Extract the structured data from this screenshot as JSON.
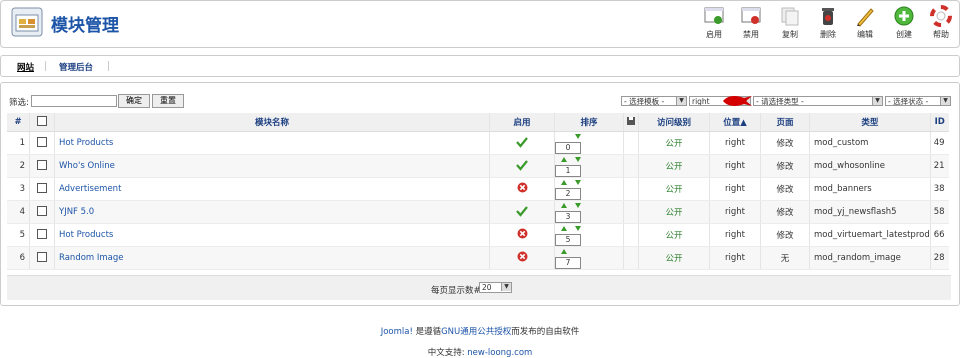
{
  "page_title": "模块管理",
  "toolbar": [
    {
      "label": "启用",
      "icon": "enable-icon"
    },
    {
      "label": "禁用",
      "icon": "disable-icon"
    },
    {
      "label": "复制",
      "icon": "copy-icon"
    },
    {
      "label": "删除",
      "icon": "trash-icon"
    },
    {
      "label": "编辑",
      "icon": "edit-icon"
    },
    {
      "label": "创建",
      "icon": "new-icon"
    },
    {
      "label": "帮助",
      "icon": "help-icon"
    }
  ],
  "tabs": [
    {
      "label": "网站",
      "active": true
    },
    {
      "label": "管理后台",
      "active": false
    }
  ],
  "filter": {
    "label": "筛选:",
    "value": "",
    "go_label": "确定",
    "reset_label": "重置",
    "template_select": "- 选择模板 -",
    "position_select": "right",
    "type_select": "- 请选择类型 -",
    "state_select": "- 选择状态 -"
  },
  "columns": {
    "num": "#",
    "name": "模块名称",
    "enabled": "启用",
    "order": "排序",
    "access": "访问级别",
    "position": "位置",
    "pages": "页面",
    "type": "类型",
    "id": "ID"
  },
  "rows": [
    {
      "num": "1",
      "name": "Hot Products",
      "enabled": true,
      "up": false,
      "down": true,
      "order": "0",
      "access": "公开",
      "position": "right",
      "pages": "修改",
      "type": "mod_custom",
      "id": "49"
    },
    {
      "num": "2",
      "name": "Who's Online",
      "enabled": true,
      "up": true,
      "down": true,
      "order": "1",
      "access": "公开",
      "position": "right",
      "pages": "修改",
      "type": "mod_whosonline",
      "id": "21"
    },
    {
      "num": "3",
      "name": "Advertisement",
      "enabled": false,
      "up": true,
      "down": true,
      "order": "2",
      "access": "公开",
      "position": "right",
      "pages": "修改",
      "type": "mod_banners",
      "id": "38"
    },
    {
      "num": "4",
      "name": "YJNF 5.0",
      "enabled": true,
      "up": true,
      "down": true,
      "order": "3",
      "access": "公开",
      "position": "right",
      "pages": "修改",
      "type": "mod_yj_newsflash5",
      "id": "58"
    },
    {
      "num": "5",
      "name": "Hot Products",
      "enabled": false,
      "up": true,
      "down": true,
      "order": "5",
      "access": "公开",
      "position": "right",
      "pages": "修改",
      "type": "mod_virtuemart_latestprod",
      "id": "66"
    },
    {
      "num": "6",
      "name": "Random Image",
      "enabled": false,
      "up": true,
      "down": false,
      "order": "7",
      "access": "公开",
      "position": "right",
      "pages": "无",
      "type": "mod_random_image",
      "id": "28"
    }
  ],
  "pager": {
    "label": "每页显示数#",
    "value": "20"
  },
  "footer": {
    "joomla": "Joomla!",
    "mid": " 是遵循",
    "gpl": "GNU通用公共授权",
    "tail": "而发布的自由软件",
    "support_label": "中文支持: ",
    "support_link": "new-loong.com"
  },
  "colors": {
    "accent": "#1c54a8",
    "enabled": "#3a9a2a",
    "disabled": "#d0302a",
    "annotation": "#d40000"
  }
}
